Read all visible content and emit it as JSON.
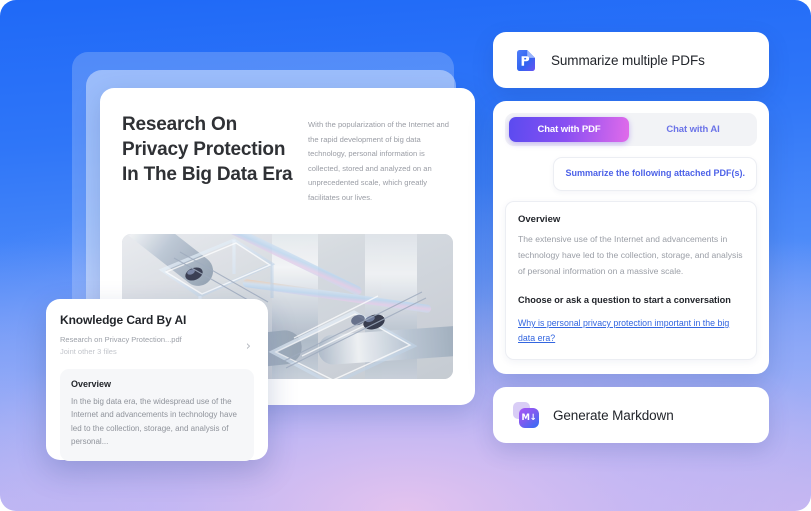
{
  "theme": {
    "bg_top": "#1f69f7",
    "bg_bottom": "#b8b4ee",
    "accent_gradient_start": "#5b4bf0",
    "accent_gradient_end": "#e06bea",
    "link_color": "#3366e0",
    "user_text_color": "#4d62e8"
  },
  "document": {
    "title": "Research On Privacy Protection In The Big Data Era",
    "body": "With the popularization of the Internet and the rapid development of big data technology, personal information is collected, stored and analyzed on an unprecedented scale, which greatly facilitates our lives.",
    "image_alt": "abstract-3d-glass-render"
  },
  "knowledge_card": {
    "title": "Knowledge Card By AI",
    "file_name": "Research on Privacy Protection...pdf",
    "files_more": "Joint other 3 files",
    "chevron": "›",
    "overview_title": "Overview",
    "overview_text": "In the big data era, the widespread use of the Internet and advancements in technology have led to the collection, storage, and analysis of personal..."
  },
  "summarize_card": {
    "label": "Summarize multiple PDFs",
    "icon": "pdf-file-icon"
  },
  "chat_panel": {
    "tabs": [
      {
        "label": "Chat with PDF",
        "active": true
      },
      {
        "label": "Chat with AI",
        "active": false
      }
    ],
    "user_message": "Summarize the following attached PDF(s).",
    "assistant": {
      "heading": "Overview",
      "text": "The extensive use of the Internet and advancements in technology have led to the collection, storage, and analysis of personal information on a massive scale.",
      "subheading": "Choose or ask a question to start a conversation",
      "suggested_question": "Why is personal privacy protection important in the big data era?"
    }
  },
  "markdown_card": {
    "label": "Generate Markdown",
    "icon": "markdown-icon",
    "icon_glyph": "M↓"
  }
}
